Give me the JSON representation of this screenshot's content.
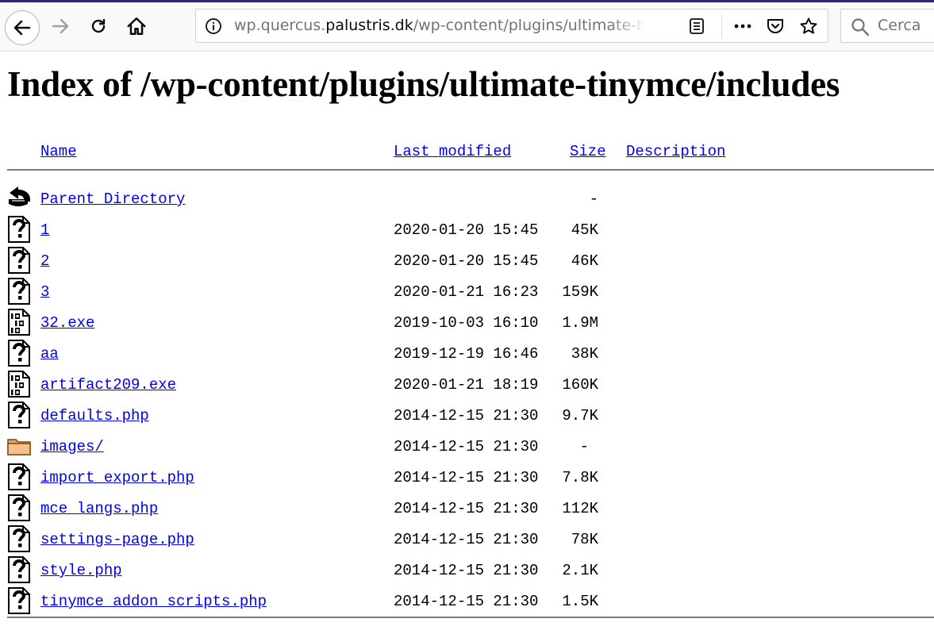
{
  "browser": {
    "url_prefix": "wp.quercus.",
    "url_host": "palustris.dk",
    "url_path": "/wp-content/plugins/ultimate-tin",
    "search_placeholder": "Cerca",
    "accent_color": "#2b2a6e"
  },
  "page": {
    "title": "Index of /wp-content/plugins/ultimate-tinymce/includes",
    "columns": {
      "name": "Name",
      "last_modified": "Last modified",
      "size": "Size",
      "description": "Description"
    },
    "parent": {
      "name": "Parent Directory",
      "size": "-",
      "icon": "back-arrow-icon"
    },
    "entries": [
      {
        "name": "1",
        "date": "2020-01-20 15:45",
        "size": "45K",
        "icon": "unknown-file-icon"
      },
      {
        "name": "2",
        "date": "2020-01-20 15:45",
        "size": "46K",
        "icon": "unknown-file-icon"
      },
      {
        "name": "3",
        "date": "2020-01-21 16:23",
        "size": "159K",
        "icon": "unknown-file-icon"
      },
      {
        "name": "32.exe",
        "date": "2019-10-03 16:10",
        "size": "1.9M",
        "icon": "binary-file-icon"
      },
      {
        "name": "aa",
        "date": "2019-12-19 16:46",
        "size": "38K",
        "icon": "unknown-file-icon"
      },
      {
        "name": "artifact209.exe",
        "date": "2020-01-21 18:19",
        "size": "160K",
        "icon": "binary-file-icon"
      },
      {
        "name": "defaults.php",
        "date": "2014-12-15 21:30",
        "size": "9.7K",
        "icon": "unknown-file-icon"
      },
      {
        "name": "images/",
        "date": "2014-12-15 21:30",
        "size": "-",
        "icon": "folder-icon"
      },
      {
        "name": "import_export.php",
        "date": "2014-12-15 21:30",
        "size": "7.8K",
        "icon": "unknown-file-icon"
      },
      {
        "name": "mce_langs.php",
        "date": "2014-12-15 21:30",
        "size": "112K",
        "icon": "unknown-file-icon"
      },
      {
        "name": "settings-page.php",
        "date": "2014-12-15 21:30",
        "size": "78K",
        "icon": "unknown-file-icon"
      },
      {
        "name": "style.php",
        "date": "2014-12-15 21:30",
        "size": "2.1K",
        "icon": "unknown-file-icon"
      },
      {
        "name": "tinymce_addon_scripts.php",
        "date": "2014-12-15 21:30",
        "size": "1.5K",
        "icon": "unknown-file-icon"
      }
    ]
  }
}
